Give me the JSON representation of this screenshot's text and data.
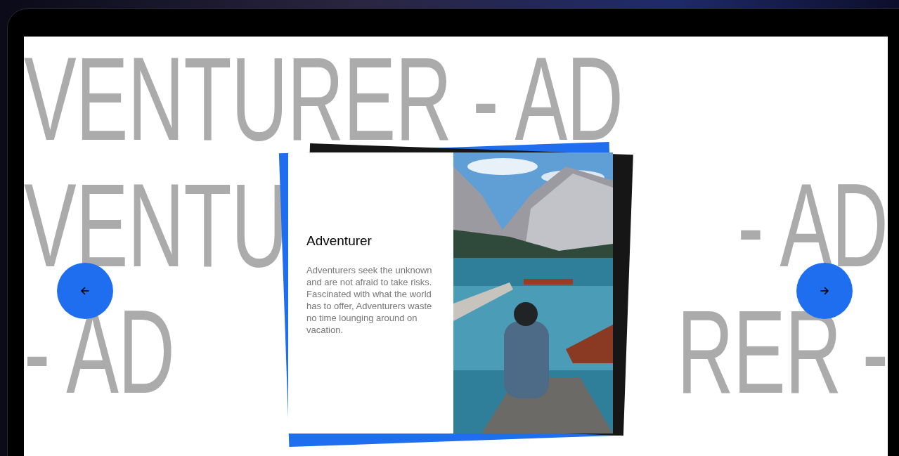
{
  "background_rows": [
    {
      "segments": [
        "VENTURER - AD"
      ]
    },
    {
      "segments": [
        "VENTU",
        "- AD"
      ]
    },
    {
      "segments": [
        "- AD",
        "RER -"
      ]
    }
  ],
  "card": {
    "title": "Adventurer",
    "description": "Adventurers seek the unknown and are not afraid to take risks. Fascinated with what the world has to offer, Adventurers waste no time lounging around on vacation."
  }
}
